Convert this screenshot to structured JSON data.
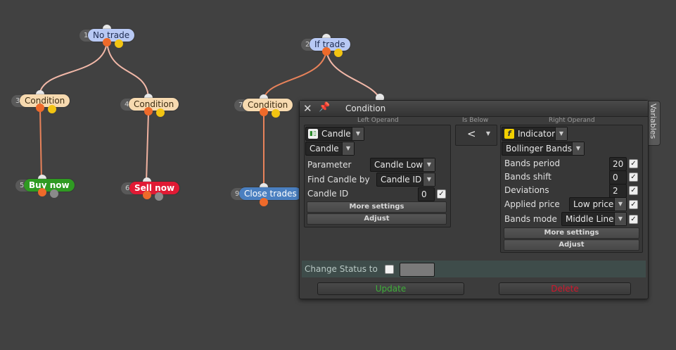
{
  "nodes": [
    {
      "num": "1",
      "label": "No trade"
    },
    {
      "num": "2",
      "label": "If trade"
    },
    {
      "num": "3",
      "label": "Condition"
    },
    {
      "num": "4",
      "label": "Condition"
    },
    {
      "num": "5",
      "label": "Buy now"
    },
    {
      "num": "6",
      "label": "Sell now"
    },
    {
      "num": "7",
      "label": "Condition"
    },
    {
      "num": "9",
      "label": "Close trades"
    }
  ],
  "dialog": {
    "title": "Condition",
    "side_tab": "Variables",
    "left_operand_label": "Left Operand",
    "is_below_label": "Is Below",
    "right_operand_label": "Right Operand",
    "left": {
      "type": "Candle",
      "subtype": "Candle",
      "parameter_label": "Parameter",
      "parameter_value": "Candle Low",
      "find_by_label": "Find Candle by",
      "find_by_value": "Candle ID",
      "candle_id_label": "Candle ID",
      "candle_id_value": "0",
      "more_settings": "More settings",
      "adjust": "Adjust"
    },
    "operator": "<",
    "right": {
      "type": "Indicator",
      "subtype": "Bollinger Bands",
      "bands_period_label": "Bands period",
      "bands_period_value": "20",
      "bands_shift_label": "Bands shift",
      "bands_shift_value": "0",
      "deviations_label": "Deviations",
      "deviations_value": "2",
      "applied_price_label": "Applied price",
      "applied_price_value": "Low price",
      "bands_mode_label": "Bands mode",
      "bands_mode_value": "Middle Line",
      "more_settings": "More settings",
      "adjust": "Adjust"
    },
    "change_status_label": "Change Status to",
    "update_button": "Update",
    "delete_button": "Delete"
  },
  "colors": {
    "update": "#3fae3a",
    "delete": "#d2162c",
    "wire": "#e8825a"
  },
  "icons": [
    "close-icon",
    "pin-icon",
    "candle-icon",
    "function-icon",
    "chevron-down-icon",
    "checkbox-icon"
  ]
}
